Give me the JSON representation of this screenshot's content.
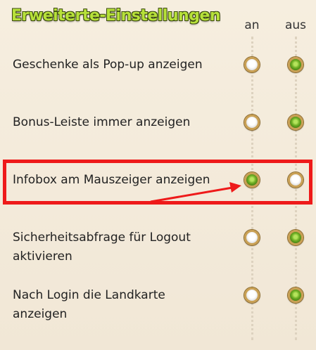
{
  "title": "Erweiterte-Einstellungen",
  "columns": {
    "on": "an",
    "off": "aus"
  },
  "rows": [
    {
      "label_lines": [
        "Geschenke als Pop-up anzeigen",
        ""
      ],
      "selected": "aus"
    },
    {
      "label_lines": [
        "Bonus-Leiste immer anzeigen",
        ""
      ],
      "selected": "aus"
    },
    {
      "label_lines": [
        "Infobox am Mauszeiger anzeigen",
        ""
      ],
      "selected": "an"
    },
    {
      "label_lines": [
        "Sicherheitsabfrage für Logout",
        "aktivieren"
      ],
      "selected": "aus"
    },
    {
      "label_lines": [
        "Nach Login die Landkarte",
        "anzeigen"
      ],
      "selected": "aus"
    }
  ],
  "colors": {
    "highlight": "#ee1a1a",
    "title": "#b7e13a",
    "radio_selected": "#6fae25"
  }
}
